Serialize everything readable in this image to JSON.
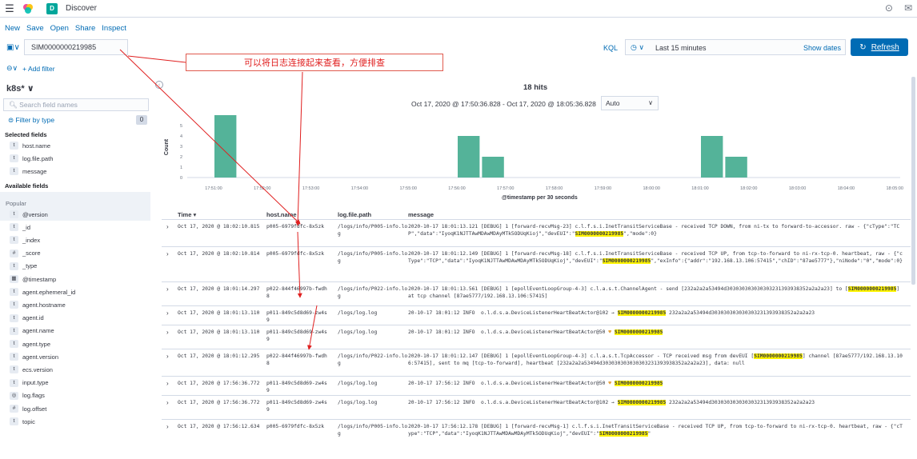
{
  "header": {
    "app_title": "Discover",
    "space_letter": "D"
  },
  "menu": [
    "New",
    "Save",
    "Open",
    "Share",
    "Inspect"
  ],
  "query": {
    "value": "SIM0000000219985",
    "language": "KQL"
  },
  "time": {
    "label": "Last 15 minutes",
    "show_dates": "Show dates",
    "refresh": "Refresh"
  },
  "annotation": "可以将日志连接起来查看，方便排查",
  "filters": {
    "add_filter": "+ Add filter"
  },
  "sidebar": {
    "index_pattern": "k8s*",
    "search_placeholder": "Search field names",
    "filter_by_type": "Filter by type",
    "filter_count": "0",
    "selected_title": "Selected fields",
    "selected": [
      {
        "type": "t",
        "name": "host.name"
      },
      {
        "type": "t",
        "name": "log.file.path"
      },
      {
        "type": "t",
        "name": "message"
      }
    ],
    "available_title": "Available fields",
    "popular_label": "Popular",
    "available": [
      {
        "type": "t",
        "name": "@version"
      },
      {
        "type": "t",
        "name": "_id"
      },
      {
        "type": "t",
        "name": "_index"
      },
      {
        "type": "#",
        "name": "_score"
      },
      {
        "type": "t",
        "name": "_type"
      },
      {
        "type": "▦",
        "name": "@timestamp"
      },
      {
        "type": "t",
        "name": "agent.ephemeral_id"
      },
      {
        "type": "t",
        "name": "agent.hostname"
      },
      {
        "type": "t",
        "name": "agent.id"
      },
      {
        "type": "t",
        "name": "agent.name"
      },
      {
        "type": "t",
        "name": "agent.type"
      },
      {
        "type": "t",
        "name": "agent.version"
      },
      {
        "type": "t",
        "name": "ecs.version"
      },
      {
        "type": "t",
        "name": "input.type"
      },
      {
        "type": "◎",
        "name": "log.flags"
      },
      {
        "type": "#",
        "name": "log.offset"
      },
      {
        "type": "t",
        "name": "topic"
      }
    ]
  },
  "hits": {
    "count": "18",
    "label": "hits",
    "range": "Oct 17, 2020 @ 17:50:36.828 - Oct 17, 2020 @ 18:05:36.828",
    "interval": "Auto"
  },
  "chart_data": {
    "type": "bar",
    "ylabel": "Count",
    "xlabel": "@timestamp per 30 seconds",
    "ylim": [
      0,
      6
    ],
    "yticks": [
      0,
      1,
      2,
      3,
      4,
      5
    ],
    "xticks": [
      "17:51:00",
      "17:52:00",
      "17:53:00",
      "17:54:00",
      "17:55:00",
      "17:56:00",
      "17:57:00",
      "17:58:00",
      "17:59:00",
      "18:00:00",
      "18:01:00",
      "18:02:00",
      "18:03:00",
      "18:04:00",
      "18:05:00"
    ],
    "bars": [
      {
        "x": "17:51:00",
        "value": 6
      },
      {
        "x": "17:56:00",
        "value": 4
      },
      {
        "x": "17:56:30",
        "value": 2
      },
      {
        "x": "18:01:00",
        "value": 4
      },
      {
        "x": "18:01:30",
        "value": 2
      }
    ],
    "bar_color": "#54b399",
    "now_line_color": "#e7664c"
  },
  "table": {
    "columns": [
      "Time",
      "host.name",
      "log.file.path",
      "message"
    ],
    "highlight": "SIM0000000219985",
    "rows": [
      {
        "time": "Oct 17, 2020 @ 18:02:10.815",
        "host": "p005-6979fdfc-8x5zk",
        "path": "/logs/info/P005-info.log",
        "msg": "2020-10-17 18:01:13.121 [DEBUG] 1 [forward-recvMsg-23] c.l.f.s.i.InetTransitServiceBase - received TCP DOWN, from ni-tx to forward-to-accessor. raw - {\"cType\":\"TCP\",\"data\":\"IyoqK1NJTTAwMDAwMDAyMTk5ODUqKioj\",\"devEUI\":\"SIM0000000219985\",\"mode\":0}"
      },
      {
        "time": "Oct 17, 2020 @ 18:02:10.814",
        "host": "p005-6979fdfc-8x5zk",
        "path": "/logs/info/P005-info.log",
        "msg": "2020-10-17 18:01:12.149 [DEBUG] 1 [forward-recvMsg-18] c.l.f.s.i.InetTransitServiceBase - received TCP UP, from tcp-to-forward to ni-rx-tcp-0. heartbeat, raw - {\"cType\":\"TCP\",\"data\":\"IyoqK1NJTTAwMDAwMDAyMTk5ODUqKioj\",\"devEUI\":\"SIM0000000219985\",\"exInfo\":{\"addr\":\"192.168.13.106:57415\",\"chID\":\"87ae5777\"},\"niNode\":\"0\",\"mode\":0}"
      },
      {
        "time": "Oct 17, 2020 @ 18:01:14.297",
        "host": "p022-844f46997b-fwdh8",
        "path": "/logs/info/P022-info.log",
        "msg": "2020-10-17 18:01:13.561 [DEBUG] 1 [epollEventLoopGroup-4-3] c.l.a.s.t.ChannelAgent - send [232a2a2a53494d303030303030303231393938352a2a2a23] to [SIM0000000219985] at tcp channel [87ae5777/192.168.13.106:57415]"
      },
      {
        "time": "Oct 17, 2020 @ 18:01:13.110",
        "host": "p011-849c5d8d69-zw4s9",
        "path": "/logs/log.log",
        "msg": "20-10-17 18:01:12 INFO  o.l.d.s.a.DeviceListenerHeartBeatActor@102 → SIM0000000219985 232a2a2a53494d303030303030303231393938352a2a2a23"
      },
      {
        "time": "Oct 17, 2020 @ 18:01:13.110",
        "host": "p011-849c5d8d69-zw4s9",
        "path": "/logs/log.log",
        "msg": "20-10-17 18:01:12 INFO  o.l.d.s.a.DeviceListenerHeartBeatActor@50 ♥ SIM0000000219985"
      },
      {
        "time": "Oct 17, 2020 @ 18:01:12.295",
        "host": "p022-844f46997b-fwdh8",
        "path": "/logs/info/P022-info.log",
        "msg": "2020-10-17 18:01:12.147 [DEBUG] 1 [epollEventLoopGroup-4-3] c.l.a.s.t.TcpAccessor - TCP received msg from devEUI [SIM0000000219985] channel [87ae5777/192.168.13.106:57415], sent to mq [tcp-to-forward], heartbeat [232a2a2a53494d303030303030303231393938352a2a2a23], data: null"
      },
      {
        "time": "Oct 17, 2020 @ 17:56:36.772",
        "host": "p011-849c5d8d69-zw4s9",
        "path": "/logs/log.log",
        "msg": "20-10-17 17:56:12 INFO  o.l.d.s.a.DeviceListenerHeartBeatActor@50 ♥ SIM0000000219985"
      },
      {
        "time": "Oct 17, 2020 @ 17:56:36.772",
        "host": "p011-849c5d8d69-zw4s9",
        "path": "/logs/log.log",
        "msg": "20-10-17 17:56:12 INFO  o.l.d.s.a.DeviceListenerHeartBeatActor@102 → SIM0000000219985 232a2a2a53494d303030303030303231393938352a2a2a23"
      },
      {
        "time": "Oct 17, 2020 @ 17:56:12.634",
        "host": "p005-6979fdfc-8x5zk",
        "path": "/logs/info/P005-info.log",
        "msg": "2020-10-17 17:56:12.178 [DEBUG] 1 [forward-recvMsg-1] c.l.f.s.i.InetTransitServiceBase - received TCP UP, from tcp-to-forward to ni-rx-tcp-0. heartbeat, raw - {\"cType\":\"TCP\",\"data\":\"IyoqK1NJTTAwMDAwMDAyMTk5ODUqKioj\",\"devEUI\":\"SIM0000000219985\""
      }
    ]
  }
}
